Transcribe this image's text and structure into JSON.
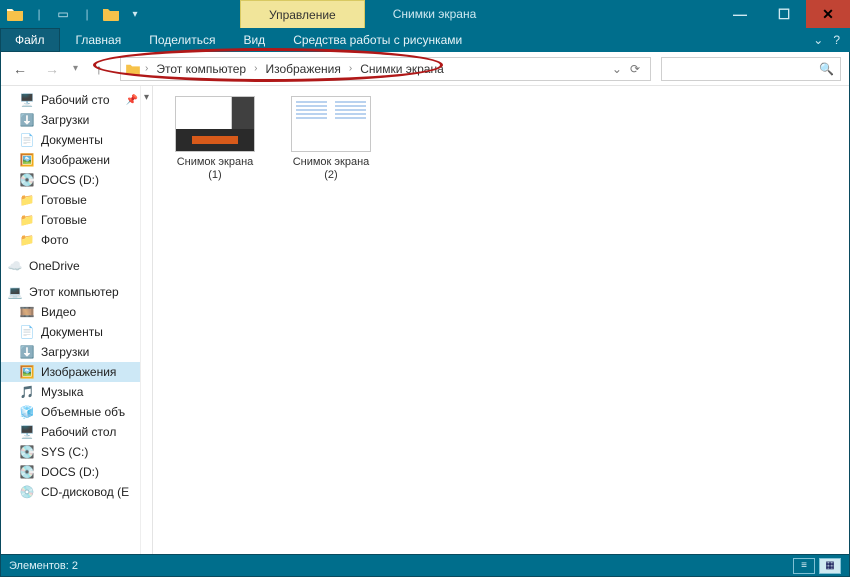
{
  "titlebar": {
    "contextual_tab": "Управление",
    "window_title": "Снимки экрана"
  },
  "window_controls": {
    "min": "—",
    "max": "☐",
    "close": "✕"
  },
  "ribbon": {
    "file": "Файл",
    "tabs": [
      "Главная",
      "Поделиться",
      "Вид",
      "Средства работы с рисунками"
    ],
    "expand": "⌄",
    "help": "?"
  },
  "nav": {
    "back": "←",
    "forward": "→",
    "recent": "▾",
    "up": "↑",
    "refresh": "⟳",
    "dropdown": "⌄"
  },
  "breadcrumb": {
    "segments": [
      "Этот компьютер",
      "Изображения",
      "Снимки экрана"
    ]
  },
  "search": {
    "icon": "🔍"
  },
  "sidebar": {
    "quick": [
      {
        "icon": "🖥️",
        "label": "Рабочий сто",
        "pin": "📌"
      },
      {
        "icon": "⬇️",
        "label": "Загрузки"
      },
      {
        "icon": "📄",
        "label": "Документы"
      },
      {
        "icon": "🖼️",
        "label": "Изображени"
      },
      {
        "icon": "💽",
        "label": "DOCS (D:)"
      },
      {
        "icon": "📁",
        "label": "Готовые"
      },
      {
        "icon": "📁",
        "label": "Готовые"
      },
      {
        "icon": "📁",
        "label": "Фото"
      }
    ],
    "onedrive": {
      "icon": "☁️",
      "label": "OneDrive"
    },
    "thispc": {
      "icon": "💻",
      "label": "Этот компьютер"
    },
    "pc_children": [
      {
        "icon": "🎞️",
        "label": "Видео"
      },
      {
        "icon": "📄",
        "label": "Документы"
      },
      {
        "icon": "⬇️",
        "label": "Загрузки"
      },
      {
        "icon": "🖼️",
        "label": "Изображения",
        "active": true
      },
      {
        "icon": "🎵",
        "label": "Музыка"
      },
      {
        "icon": "🧊",
        "label": "Объемные объ"
      },
      {
        "icon": "🖥️",
        "label": "Рабочий стол"
      },
      {
        "icon": "💽",
        "label": "SYS (C:)"
      },
      {
        "icon": "💽",
        "label": "DOCS (D:)"
      },
      {
        "icon": "💿",
        "label": "CD-дисковод (E"
      }
    ]
  },
  "files": [
    {
      "name_l1": "Снимок экрана",
      "name_l2": "(1)"
    },
    {
      "name_l1": "Снимок экрана",
      "name_l2": "(2)"
    }
  ],
  "status": {
    "text": "Элементов: 2"
  }
}
